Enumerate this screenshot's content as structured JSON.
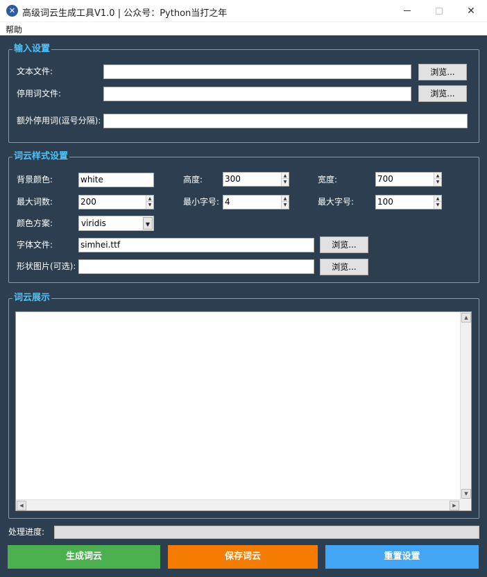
{
  "window": {
    "title": "高级词云生成工具V1.0 | 公众号：Python当打之年",
    "icon": "app-logo-icon",
    "minimize_glyph": "—",
    "close_glyph": "✕"
  },
  "menu": {
    "help": "帮助"
  },
  "input_settings": {
    "title": "输入设置",
    "text_file_label": "文本文件:",
    "text_file_value": "",
    "stopwords_label": "停用词文件:",
    "stopwords_value": "",
    "extra_stopwords_label": "额外停用词(逗号分隔):",
    "extra_stopwords_value": "",
    "browse": "浏览..."
  },
  "style_settings": {
    "title": "词云样式设置",
    "bg_color_label": "背景颜色:",
    "bg_color_value": "white",
    "height_label": "高度:",
    "height_value": "300",
    "width_label": "宽度:",
    "width_value": "700",
    "max_words_label": "最大词数:",
    "max_words_value": "200",
    "min_font_label": "最小字号:",
    "min_font_value": "4",
    "max_font_label": "最大字号:",
    "max_font_value": "100",
    "colormap_label": "颜色方案:",
    "colormap_value": "viridis",
    "font_file_label": "字体文件:",
    "font_file_value": "simhei.ttf",
    "mask_label": "形状图片(可选):",
    "mask_value": "",
    "browse": "浏览..."
  },
  "display": {
    "title": "词云展示"
  },
  "progress": {
    "label": "处理进度:",
    "fraction": 0
  },
  "actions": {
    "generate": "生成词云",
    "save": "保存词云",
    "reset": "重置设置"
  },
  "colors": {
    "background": "#2c3e50",
    "accent": "#4fc3f7",
    "generate": "#4caf50",
    "save": "#f57c00",
    "reset": "#42a5f5"
  },
  "arrows": {
    "up": "▲",
    "down": "▼",
    "left": "◀",
    "right": "▶"
  }
}
